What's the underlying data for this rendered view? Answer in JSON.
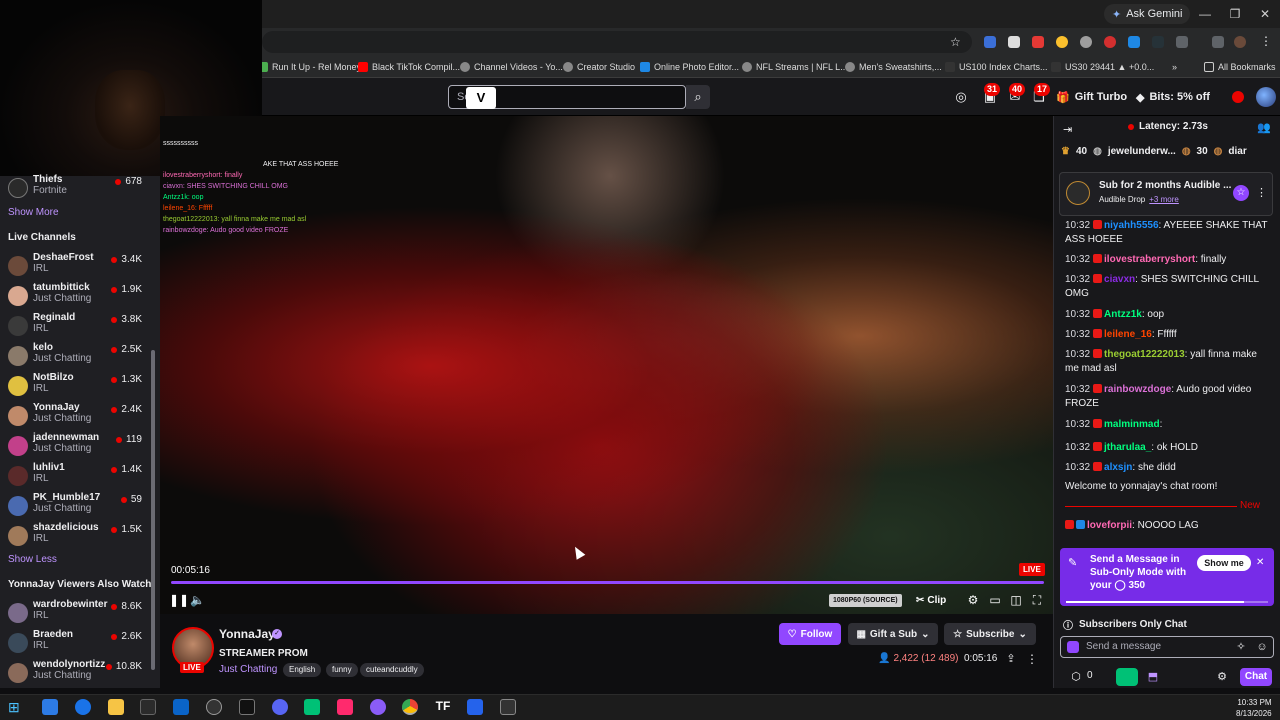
{
  "browser": {
    "ask_gemini": "Ask Gemini",
    "bookmarks": [
      "Run It Up - Rel Money",
      "Black TikTok Compil...",
      "Channel Videos - Yo...",
      "Creator Studio",
      "Online Photo Editor...",
      "NFL Streams | NFL L...",
      "Men's Sweatshirts,...",
      "US100 Index Charts...",
      "US30 29441 ▲ +0.0..."
    ],
    "all_bookmarks": "All Bookmarks"
  },
  "topnav": {
    "search_placeholder": "Se",
    "badges": {
      "a": "31",
      "b": "40",
      "c": "17"
    },
    "gift_turbo": "Gift Turbo",
    "bits_off": "Bits: 5% off"
  },
  "sidebar": {
    "top_channel": {
      "name": "Thiefs",
      "category": "Fortnite",
      "viewers": "678"
    },
    "show_more": "Show More",
    "live_channels_heading": "Live Channels",
    "live_channels": [
      {
        "name": "DeshaeFrost",
        "category": "IRL",
        "viewers": "3.4K",
        "color": "#6b4a3a"
      },
      {
        "name": "tatumbittick",
        "category": "Just Chatting",
        "viewers": "1.9K",
        "color": "#d9a890"
      },
      {
        "name": "Reginald",
        "category": "IRL",
        "viewers": "3.8K",
        "color": "#3a3a3a"
      },
      {
        "name": "kelo",
        "category": "Just Chatting",
        "viewers": "2.5K",
        "color": "#8a7a6a"
      },
      {
        "name": "NotBilzo",
        "category": "IRL",
        "viewers": "1.3K",
        "color": "#e0c040"
      },
      {
        "name": "YonnaJay",
        "category": "Just Chatting",
        "viewers": "2.4K",
        "color": "#c08a6a"
      },
      {
        "name": "jadennewman",
        "category": "Just Chatting",
        "viewers": "119",
        "color": "#c2408a"
      },
      {
        "name": "luhliv1",
        "category": "IRL",
        "viewers": "1.4K",
        "color": "#5a2a2a"
      },
      {
        "name": "PK_Humble17",
        "category": "Just Chatting",
        "viewers": "59",
        "color": "#4a6ab0"
      },
      {
        "name": "shazdelicious",
        "category": "IRL",
        "viewers": "1.5K",
        "color": "#a07a5a"
      }
    ],
    "show_less": "Show Less",
    "also_watch_heading": "YonnaJay Viewers Also Watch",
    "also_watch": [
      {
        "name": "wardrobewinter",
        "category": "IRL",
        "viewers": "8.6K",
        "color": "#7a6a8a"
      },
      {
        "name": "Braeden",
        "category": "IRL",
        "viewers": "2.6K",
        "color": "#3a4a5a"
      },
      {
        "name": "wendolynortizz",
        "category": "Just Chatting",
        "viewers": "10.8K",
        "color": "#8a6a5a"
      }
    ]
  },
  "video": {
    "overlay_chat": [
      "ssssssssss",
      "AKE THAT ASS HOEEE",
      "ilovestraberryshort: finally",
      "ciavxn: SHES SWITCHING CHILL OMG",
      "Antzz1k: oop",
      "leilene_16: Ffffff",
      "thegoat12222013: yall finna make me mad asl",
      "rainbowzdoge: Audo good video FROZE"
    ],
    "time": "00:05:16",
    "live_label": "LIVE",
    "progress": 1.0,
    "quality": "1080P60 (SOURCE)",
    "clip": "Clip"
  },
  "channel": {
    "name": "YonnaJay",
    "live_label": "LIVE",
    "title": "STREAMER PROM",
    "game": "Just Chatting",
    "tags": [
      "English",
      "funny",
      "cuteandcuddly"
    ],
    "follow": "Follow",
    "gift_sub": "Gift a Sub",
    "subscribe": "Subscribe",
    "viewers": "2,422 (12 489)",
    "uptime": "0:05:16"
  },
  "chat": {
    "latency": "Latency: 2.73s",
    "leaderboard": [
      "40",
      "jewelunderw...",
      "30",
      "diar"
    ],
    "pinned_title": "Sub for 2 months Audible ...",
    "pinned_sub": "Audible Drop",
    "pinned_more": "+3 more",
    "messages": [
      {
        "ts": "10:32",
        "user": "niyahh5556",
        "color": "#1e90ff",
        "text": ": AYEEEE SHAKE THAT ASS HOEEE"
      },
      {
        "ts": "10:32",
        "user": "ilovestraberryshort",
        "color": "#ff69b4",
        "text": ": finally"
      },
      {
        "ts": "10:32",
        "user": "ciavxn",
        "color": "#8a2be2",
        "text": ": SHES SWITCHING CHILL OMG"
      },
      {
        "ts": "10:32",
        "user": "Antzz1k",
        "color": "#00ff7f",
        "text": ": oop"
      },
      {
        "ts": "10:32",
        "user": "leilene_16",
        "color": "#ff4500",
        "text": ": Ffffff"
      },
      {
        "ts": "10:32",
        "user": "thegoat12222013",
        "color": "#9acd32",
        "text": ": yall finna make me mad asl"
      },
      {
        "ts": "10:32",
        "user": "rainbowzdoge",
        "color": "#da70d6",
        "text": ": Audo good video FROZE"
      },
      {
        "ts": "10:32",
        "user": "malminmad",
        "color": "#00ff7f",
        "text": ":"
      },
      {
        "ts": "10:32",
        "user": "jtharulaa_",
        "color": "#00ff7f",
        "text": ": ok HOLD"
      },
      {
        "ts": "10:32",
        "user": "alxsjn",
        "color": "#1e90ff",
        "text": ": she didd"
      }
    ],
    "welcome": "Welcome to yonnajay's chat room!",
    "new_label": "New",
    "last_message": {
      "user": "loveforpii",
      "color": "#ff69b4",
      "text": ": NOOOO LAG"
    },
    "sub_banner": "Send a Message in Sub-Only Mode with your",
    "sub_banner_cost": "350",
    "sub_banner_progress": 0.88,
    "show_me": "Show me",
    "subscribers_only": "Subscribers Only Chat",
    "input_placeholder": "Send a message",
    "points": "0",
    "send": "Chat"
  },
  "taskbar": {
    "time": "10:33 PM",
    "date": "8/13/2026"
  }
}
